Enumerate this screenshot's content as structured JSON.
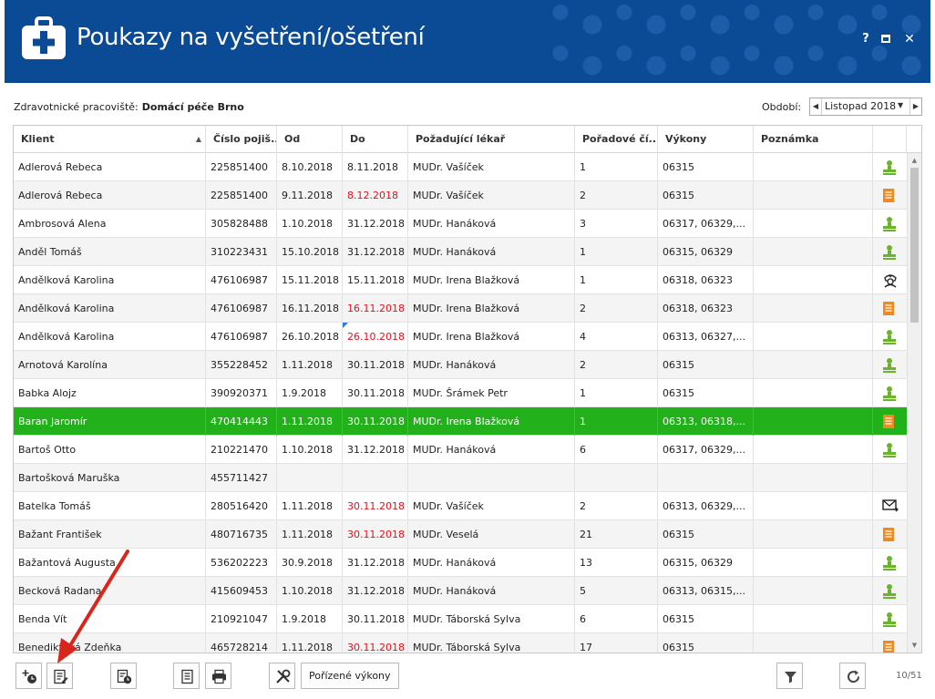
{
  "window": {
    "title": "Poukazy na vyšetření/ošetření",
    "help": "?",
    "close": "✕"
  },
  "info": {
    "workplace_label": "Zdravotnické pracoviště:",
    "workplace_value": "Domácí péče Brno",
    "period_label": "Období:",
    "period_value": "Listopad 2018"
  },
  "columns": [
    "Klient",
    "Číslo pojiš...",
    "Od",
    "Do",
    "Požadující lékař",
    "Pořadové čí...",
    "Výkony",
    "Poznámka"
  ],
  "rows": [
    {
      "client": "Adlerová Rebeca",
      "ins": "225851400",
      "from": "8.10.2018",
      "to": "8.11.2018",
      "doctor": "MUDr. Vašíček",
      "order": "1",
      "procedures": "06315",
      "note": "",
      "icon": "person",
      "red": false
    },
    {
      "client": "Adlerová Rebeca",
      "ins": "225851400",
      "from": "9.11.2018",
      "to": "8.12.2018",
      "doctor": "MUDr. Vašíček",
      "order": "2",
      "procedures": "06315",
      "note": "",
      "icon": "doc",
      "red": true
    },
    {
      "client": "Ambrosová Alena",
      "ins": "305828488",
      "from": "1.10.2018",
      "to": "31.12.2018",
      "doctor": "MUDr. Hanáková",
      "order": "3",
      "procedures": "06317, 06329,...",
      "note": "",
      "icon": "person",
      "red": false
    },
    {
      "client": "Anděl Tomáš",
      "ins": "310223431",
      "from": "15.10.2018",
      "to": "31.12.2018",
      "doctor": "MUDr. Hanáková",
      "order": "1",
      "procedures": "06315, 06329",
      "note": "",
      "icon": "person",
      "red": false
    },
    {
      "client": "Andělková Karolina",
      "ins": "476106987",
      "from": "15.11.2018",
      "to": "15.11.2018",
      "doctor": "MUDr. Irena Blažková",
      "order": "1",
      "procedures": "06318, 06323",
      "note": "",
      "icon": "nurse",
      "red": false
    },
    {
      "client": "Andělková Karolina",
      "ins": "476106987",
      "from": "16.11.2018",
      "to": "16.11.2018",
      "doctor": "MUDr. Irena Blažková",
      "order": "2",
      "procedures": "06318, 06323",
      "note": "",
      "icon": "doc",
      "red": true
    },
    {
      "client": "Andělková Karolina",
      "ins": "476106987",
      "from": "26.10.2018",
      "to": "26.10.2018",
      "doctor": "MUDr. Irena Blažková",
      "order": "4",
      "procedures": "06313, 06327,...",
      "note": "",
      "icon": "person",
      "red": true,
      "flag": true
    },
    {
      "client": "Arnotová Karolína",
      "ins": "355228452",
      "from": "1.11.2018",
      "to": "30.11.2018",
      "doctor": "MUDr. Hanáková",
      "order": "2",
      "procedures": "06315",
      "note": "",
      "icon": "person",
      "red": false
    },
    {
      "client": "Babka Alojz",
      "ins": "390920371",
      "from": "1.9.2018",
      "to": "30.11.2018",
      "doctor": "MUDr. Šrámek Petr",
      "order": "1",
      "procedures": "06315",
      "note": "",
      "icon": "person",
      "red": false
    },
    {
      "client": "Baran Jaromír",
      "ins": "470414443",
      "from": "1.11.2018",
      "to": "30.11.2018",
      "doctor": "MUDr. Irena Blažková",
      "order": "1",
      "procedures": "06313, 06318,...",
      "note": "",
      "icon": "doc",
      "red": false,
      "selected": true
    },
    {
      "client": "Bartoš Otto",
      "ins": "210221470",
      "from": "1.10.2018",
      "to": "31.12.2018",
      "doctor": "MUDr. Hanáková",
      "order": "6",
      "procedures": "06317, 06329,...",
      "note": "",
      "icon": "person",
      "red": false
    },
    {
      "client": "Bartošková Maruška",
      "ins": "455711427",
      "from": "",
      "to": "",
      "doctor": "",
      "order": "",
      "procedures": "",
      "note": "",
      "icon": "",
      "red": false
    },
    {
      "client": "Batelka Tomáš",
      "ins": "280516420",
      "from": "1.11.2018",
      "to": "30.11.2018",
      "doctor": "MUDr. Vašíček",
      "order": "2",
      "procedures": "06313, 06329,...",
      "note": "",
      "icon": "mail",
      "red": true
    },
    {
      "client": "Bažant František",
      "ins": "480716735",
      "from": "1.11.2018",
      "to": "30.11.2018",
      "doctor": "MUDr. Veselá",
      "order": "21",
      "procedures": "06315",
      "note": "",
      "icon": "doc",
      "red": true
    },
    {
      "client": "Bažantová Augusta",
      "ins": "536202223",
      "from": "30.9.2018",
      "to": "31.12.2018",
      "doctor": "MUDr. Hanáková",
      "order": "13",
      "procedures": "06315, 06329",
      "note": "",
      "icon": "person",
      "red": false
    },
    {
      "client": "Becková Radana",
      "ins": "415609453",
      "from": "1.10.2018",
      "to": "31.12.2018",
      "doctor": "MUDr. Hanáková",
      "order": "5",
      "procedures": "06313, 06315,...",
      "note": "",
      "icon": "person",
      "red": false
    },
    {
      "client": "Benda Vít",
      "ins": "210921047",
      "from": "1.9.2018",
      "to": "30.11.2018",
      "doctor": "MUDr. Táborská Sylva",
      "order": "6",
      "procedures": "06315",
      "note": "",
      "icon": "person",
      "red": false
    },
    {
      "client": "Benediktová Zdeňka",
      "ins": "465728214",
      "from": "1.11.2018",
      "to": "30.11.2018",
      "doctor": "MUDr. Táborská Sylva",
      "order": "17",
      "procedures": "06315",
      "note": "",
      "icon": "doc",
      "red": true
    }
  ],
  "toolbar": {
    "recorded_button": "Pořízené výkony",
    "counter": "10/51"
  },
  "colors": {
    "titlebar": "#0b4a94",
    "selected_row": "#22b11b",
    "expired_date": "#e5101a",
    "icon_green": "#6ab42d",
    "icon_orange": "#f08a1c"
  }
}
